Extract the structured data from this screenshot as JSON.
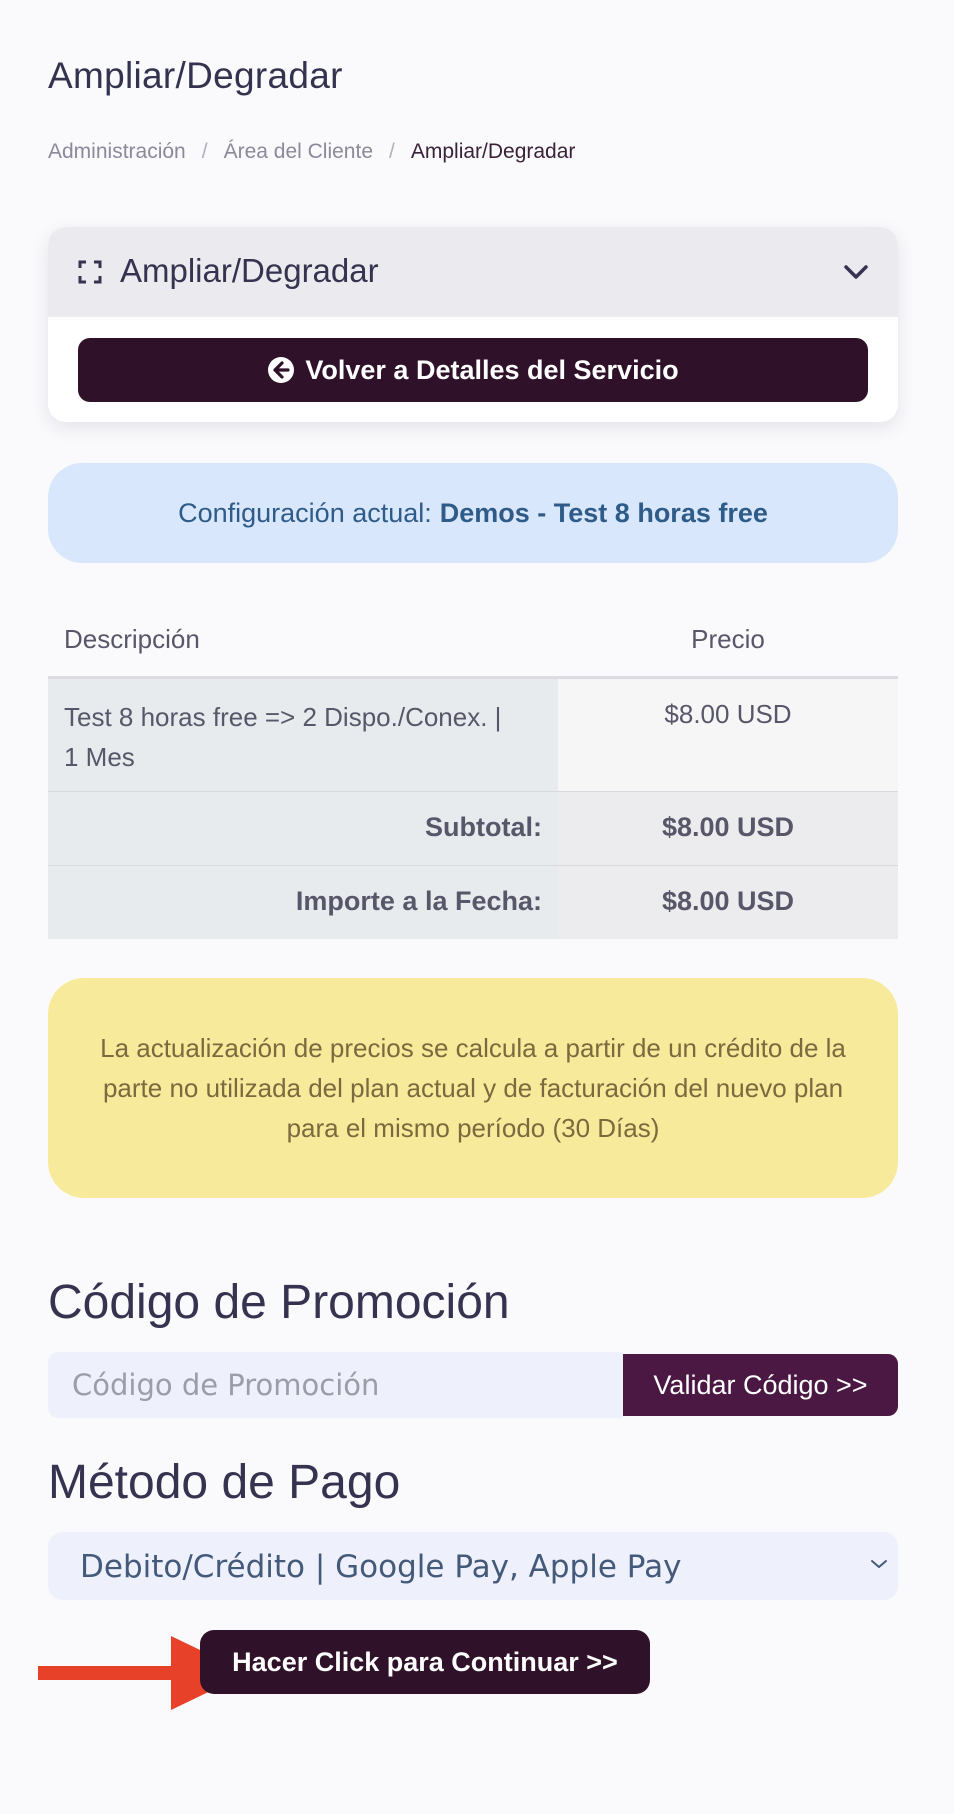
{
  "page": {
    "title": "Ampliar/Degradar"
  },
  "breadcrumb": {
    "items": [
      "Administración",
      "Área del Cliente",
      "Ampliar/Degradar"
    ],
    "separator": "/"
  },
  "panel": {
    "title": "Ampliar/Degradar",
    "back_button_label": "Volver a Detalles del Servicio"
  },
  "current_config": {
    "label": "Configuración actual:",
    "value": "Demos - Test 8 horas free"
  },
  "table": {
    "headers": [
      "Descripción",
      "Precio"
    ],
    "rows": [
      {
        "description": "Test 8 horas free => 2 Dispo./Conex. | 1 Mes",
        "price": "$8.00 USD"
      }
    ],
    "subtotal_label": "Subtotal:",
    "subtotal_value": "$8.00 USD",
    "due_label": "Importe a la Fecha:",
    "due_value": "$8.00 USD"
  },
  "notice": {
    "text": "La actualización de precios se calcula a partir de un crédito de la parte no utilizada del plan actual y de facturación del nuevo plan para el mismo período (30 Días)"
  },
  "promo": {
    "title": "Código de Promoción",
    "placeholder": "Código de Promoción",
    "value": "",
    "button_label": "Validar Código >>"
  },
  "payment": {
    "title": "Método de Pago",
    "selected": "Debito/Crédito | Google Pay, Apple Pay"
  },
  "continue_button_label": "Hacer Click para Continuar >>",
  "colors": {
    "primary_dark": "#2f1229",
    "validate_button": "#4a1843",
    "info_bg": "#d8e7fc",
    "info_text": "#2e5b87",
    "warning_bg": "#f8ea9b",
    "arrow": "#e8412a"
  }
}
